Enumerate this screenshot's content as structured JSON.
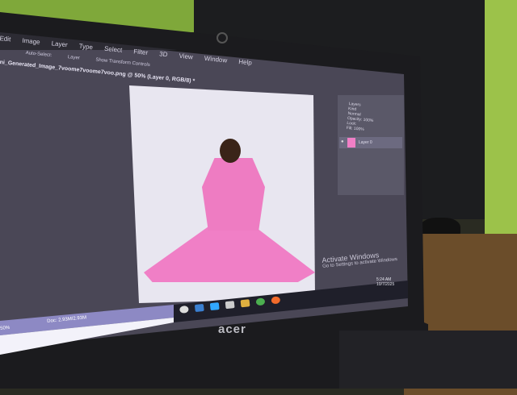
{
  "app": {
    "menu": [
      "Edit",
      "Image",
      "Layer",
      "Type",
      "Select",
      "Filter",
      "3D",
      "View",
      "Window",
      "Help"
    ],
    "options": {
      "auto_select": "Auto-Select:",
      "auto_select_value": "Layer",
      "show_transform": "Show Transform Controls"
    },
    "document_tab": "ni_Generated_Image_7voome7voome7voo.png @ 50% (Layer 0, RGB/8) *",
    "layers_panel": {
      "tab": "Layers",
      "kind": "Kind",
      "blend": "Normal",
      "opacity": "Opacity: 100%",
      "lock": "Lock:",
      "fill": "Fill: 100%",
      "layer_name": "Layer 0"
    },
    "status": {
      "zoom": "50%",
      "doc": "Doc: 2.93M/2.93M"
    }
  },
  "windows": {
    "activate_title": "Activate Windows",
    "activate_sub": "Go to Settings to activate Windows",
    "time": "5:24 AM",
    "date": "10/7/2025"
  },
  "laptop_brand": "acer"
}
